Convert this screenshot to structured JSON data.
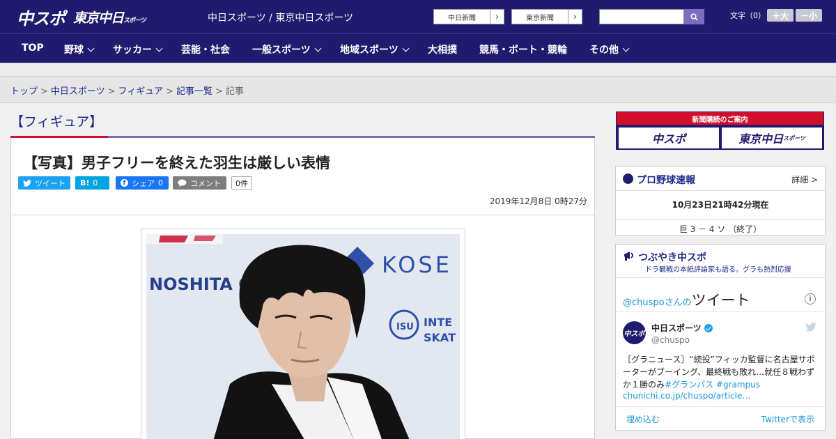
{
  "header": {
    "logo_main": "中スポ",
    "logo_sub": "東京中日",
    "logo_sub_small": "スポーツ",
    "site_name": "中日スポーツ / 東京中日スポーツ",
    "ext_link_1": "中日新聞",
    "ext_link_2": "東京新聞",
    "fontsize_label": "文字（0）",
    "fontsize_plus": "＋大",
    "fontsize_minus": "－小"
  },
  "nav": {
    "items": [
      "TOP",
      "野球",
      "サッカー",
      "芸能・社会",
      "一般スポーツ",
      "地域スポーツ",
      "大相撲",
      "競馬・ボート・競輪",
      "その他"
    ]
  },
  "breadcrumb": {
    "items": [
      "トップ",
      "中日スポーツ",
      "フィギュア",
      "記事一覧"
    ],
    "current": "記事",
    "separator": ">"
  },
  "article": {
    "category": "【フィギュア】",
    "title": "【写真】男子フリーを終えた羽生は厳しい表情",
    "tweet_label": "ツイート",
    "hatena_label": "B!",
    "hatena_count": "0",
    "facebook_label": "シェア",
    "facebook_count": "0",
    "comment_label": "コメント",
    "comment_count": "0件",
    "date": "2019年12月8日 0時27分",
    "photo_texts": {
      "banner_1": "NOSHITA GRO",
      "banner_2": "KOSE",
      "isu_1": "INTE",
      "isu_2": "SKAT",
      "isu_logo": "ISU"
    }
  },
  "sidebar": {
    "subscribe_header": "新聞購読のご案内",
    "subscribe_1": "中スポ",
    "subscribe_2": "東京中日",
    "subscribe_2_small": "スポーツ",
    "baseball": {
      "title": "プロ野球速報",
      "more": "詳細 >",
      "as_of": "10月23日21時42分現在",
      "score": "巨 3 － 4 ソ （終了）"
    },
    "tweets": {
      "title": "つぶやき中スポ",
      "subtitle": "ドラ観戦の本紙評論家も語る。グラも熱烈応援",
      "header_prefix": "@chuspoさんの",
      "header_big": "ツイート",
      "info_icon": "i",
      "name": "中日スポーツ",
      "handle": "@chuspo",
      "avatar_text": "中スポ",
      "text": "［グラニュース］“続投”フィッカ監督に名古屋サポーターがブーイング、最終戦も敗れ…就任８戦わずか１勝のみ",
      "tag_1": "#グランパス",
      "tag_2": "#grampus",
      "link": "chunichi.co.jp/chuspo/article…",
      "embed": "埋め込む",
      "view": "Twitterで表示"
    }
  },
  "colors": {
    "header_bg": "#201b6e",
    "accent_red": "#d0102a",
    "link_blue": "#1c2a8c",
    "twitter_blue": "#1b95e0"
  }
}
